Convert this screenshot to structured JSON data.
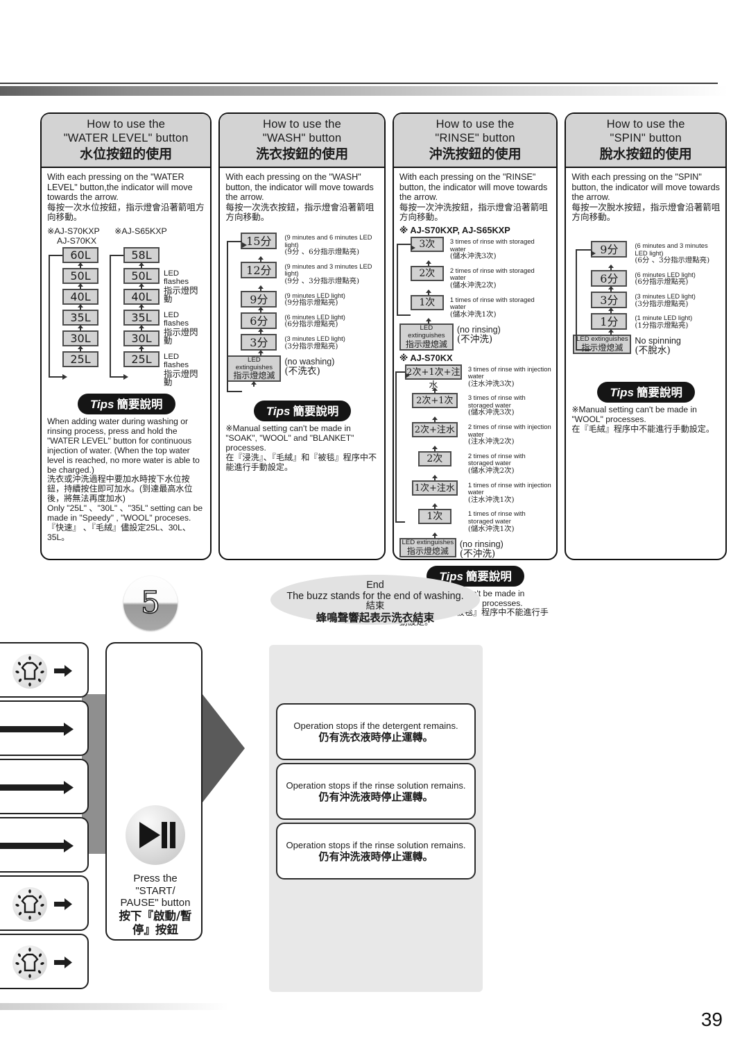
{
  "page": {
    "number": "39"
  },
  "panels": [
    {
      "title_en_line1": "How to use the",
      "title_en_line2": "\"WATER LEVEL\" button",
      "title_zh": "水位按鈕的使用",
      "intro_en": "With each pressing on the \"WATER LEVEL\" button,the indicator will move towards the arrow.",
      "intro_zh": "每按一次水位按鈕，指示燈會沿著箭咀方向移動。",
      "model_a_line1": "※AJ-S70KXP",
      "model_a_line2": "AJ-S70KX",
      "model_b": "※AJ-S65KXP",
      "levels_a": [
        "60L",
        "50L",
        "40L",
        "35L",
        "30L",
        "25L"
      ],
      "levels_b": [
        "58L",
        "50L",
        "40L",
        "35L",
        "30L",
        "25L"
      ],
      "led_notes": [
        {
          "at": 1,
          "en": "LED flashes",
          "zh": "指示燈閃動"
        },
        {
          "at": 3,
          "en": "LED flashes",
          "zh": "指示燈閃動"
        },
        {
          "at": 5,
          "en": "LED flashes",
          "zh": "指示燈閃動"
        }
      ],
      "tips_en": "Tips",
      "tips_zh": "簡要說明",
      "tip_body_en1": "When adding water during washing or rinsing process, press and hold the \"WATER LEVEL\" button for continuous injection of water. (When the top water level is reached, no more water is able to be charged.)",
      "tip_body_zh1": "洗衣或沖洗過程中要加水時按下水位按鈕，持續按住即可加水。(到達最高水位後，將無法再度加水)",
      "tip_body_en2": "Only \"25L\" 、\"30L\" 、\"35L\" setting can be made in \"Speedy\" , \"WOOL\" proceses.",
      "tip_body_zh2": "『快速』 、『毛絨』儘設定25L、30L、35L。"
    },
    {
      "title_en_line1": "How to use the",
      "title_en_line2": "\"WASH\" button",
      "title_zh": "洗衣按鈕的使用",
      "intro_en": "With each pressing on the \"WASH\" button, the indicator will move towards the arrow.",
      "intro_zh": "每按一次洗衣按鈕，指示燈會沿著箭咀方向移動。",
      "steps": [
        {
          "label": "15分",
          "en": "(9 minutes and 6 minutes LED light)",
          "zh": "(9分 、6分指示燈點亮)"
        },
        {
          "label": "12分",
          "en": "(9 minutes and 3 minutes LED light)",
          "zh": "(9分 、3分指示燈點亮)"
        },
        {
          "label": "9分",
          "en": "(9 minutes LED light)",
          "zh": "(9分指示燈點亮)"
        },
        {
          "label": "6分",
          "en": "(6 minutes LED light)",
          "zh": "(6分指示燈點亮)"
        },
        {
          "label": "3分",
          "en": "(3 minutes LED light)",
          "zh": "(3分指示燈點亮)"
        }
      ],
      "led_off_en": "LED extinguishes",
      "led_off_zh": "指示燈熄滅",
      "led_off_desc_en": "(no washing)",
      "led_off_desc_zh": "(不洗衣)",
      "tips_en": "Tips",
      "tips_zh": "簡要說明",
      "tip_body_en": "※Manual setting can't be made in \"SOAK\", \"WOOL\" and \"BLANKET\" processes.",
      "tip_body_zh": "在『浸洗』、『毛絨』和『被毯』程序中不能進行手動設定。"
    },
    {
      "title_en_line1": "How to use the",
      "title_en_line2": "\"RINSE\" button",
      "title_zh": "沖洗按鈕的使用",
      "intro_en": "With each pressing on the \"RINSE\" button, the indicator will move towards the arrow.",
      "intro_zh": "每按一次沖洗按鈕，指示燈會沿著箭咀方向移動。",
      "group1_head": "※ AJ-S70KXP, AJ-S65KXP",
      "group1_steps": [
        {
          "label": "3次",
          "en": "3 times of rinse with storaged water",
          "zh": "(儲水沖洗3次)"
        },
        {
          "label": "2次",
          "en": "2 times of rinse with storaged water",
          "zh": "(儲水沖洗2次)"
        },
        {
          "label": "1次",
          "en": "1 times of rinse with storaged water",
          "zh": "(儲水沖洗1次)"
        }
      ],
      "group1_led_en": "LED extinguishes",
      "group1_led_zh": "指示燈熄滅",
      "group1_led_desc_en": "(no rinsing)",
      "group1_led_desc_zh": "(不沖洗)",
      "group2_head": "※ AJ-S70KX",
      "group2_steps": [
        {
          "label": "2次+1次+注水",
          "en": "3 times of rinse with injection water",
          "zh": "(注水沖洗3次)"
        },
        {
          "label": "2次+1次",
          "en": "3 times of rinse with storaged water",
          "zh": "(儲水沖洗3次)"
        },
        {
          "label": "2次+注水",
          "en": "2 times of rinse with injection water",
          "zh": "(注水沖洗2次)"
        },
        {
          "label": "2次",
          "en": "2 times of rinse with storaged water",
          "zh": "(儲水沖洗2次)"
        },
        {
          "label": "1次+注水",
          "en": "1 times of rinse with injection water",
          "zh": "(注水沖洗1次)"
        },
        {
          "label": "1次",
          "en": "1 times of rinse with storaged water",
          "zh": "(儲水沖洗1次)"
        }
      ],
      "group2_led_en": "LED extinguishes",
      "group2_led_zh": "指示燈熄滅",
      "group2_led_desc_en": "(no rinsing)",
      "group2_led_desc_zh": "(不沖洗)",
      "tips_en": "Tips",
      "tips_zh": "簡要說明",
      "tip_body_en": "※Manual setting can't be made in \"WOOL\", \"BLANKET\" processes.",
      "tip_body_zh": "在『毛絨』 、『被毯』程序中不能進行手動設定。"
    },
    {
      "title_en_line1": "How to use the",
      "title_en_line2": "\"SPIN\" button",
      "title_zh": "脫水按鈕的使用",
      "intro_en": "With each pressing on the \"SPIN\" button, the indicator will move towards the arrow.",
      "intro_zh": "每按一次脫水按鈕，指示燈會沿著箭咀方向移動。",
      "steps": [
        {
          "label": "9分",
          "en": "(6 minutes and 3 minutes LED light)",
          "zh": "(6分 、3分指示燈點亮)"
        },
        {
          "label": "6分",
          "en": "(6 minutes LED light)",
          "zh": "(6分指示燈點亮)"
        },
        {
          "label": "3分",
          "en": "(3 minutes LED light)",
          "zh": "(3分指示燈點亮)"
        },
        {
          "label": "1分",
          "en": "(1 minute LED light)",
          "zh": "(1分指示燈點亮)"
        }
      ],
      "led_off_en": "LED extinguishes",
      "led_off_zh": "指示燈熄滅",
      "led_off_desc_en": "No spinning",
      "led_off_desc_zh": "(不脫水)",
      "tips_en": "Tips",
      "tips_zh": "簡要說明",
      "tip_body_en": "※Manual setting can't be made in \"WOOL\" processes.",
      "tip_body_zh": "在『毛絨』程序中不能進行手動設定。"
    }
  ],
  "step5": {
    "number": "5",
    "end_en_title": "End",
    "end_en_sub": "The buzz stands for the end of washing.",
    "end_zh_title": "結束",
    "end_zh_sub": "蜂鳴聲響起表示洗衣結束"
  },
  "start_pause": {
    "line1": "Press the",
    "line2": "\"START/",
    "line3": "PAUSE\" button",
    "zh1": "按下『啟動/暫",
    "zh2": "停』按鈕"
  },
  "operation_boxes": [
    {
      "en": "Operation stops if the detergent remains.",
      "zh": "仍有洗衣液時停止運轉。"
    },
    {
      "en": "Operation stops if the rinse solution remains.",
      "zh": "仍有沖洗液時停止運轉。"
    },
    {
      "en": "Operation stops if the rinse solution remains.",
      "zh": "仍有沖洗液時停止運轉。"
    }
  ],
  "left_flow_boxes": [
    {
      "kind": "shirt"
    },
    {
      "kind": "arrow"
    },
    {
      "kind": "arrow"
    },
    {
      "kind": "arrow"
    },
    {
      "kind": "shirt"
    },
    {
      "kind": "shirt"
    }
  ]
}
